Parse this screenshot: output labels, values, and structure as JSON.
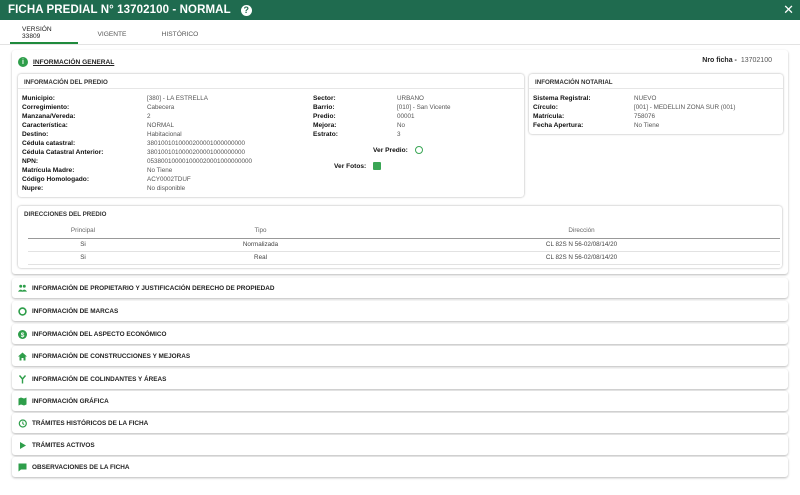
{
  "window": {
    "title": "FICHA PREDIAL N° 13702100 - NORMAL",
    "help_glyph": "?",
    "close_glyph": "✕"
  },
  "tabs": [
    {
      "label": "VERSIÓN 33809"
    },
    {
      "label": "VIGENTE"
    },
    {
      "label": "HISTÓRICO"
    }
  ],
  "general": {
    "label": "INFORMACIÓN GENERAL",
    "nro_ficha_label": "Nro ficha -",
    "nro_ficha_value": "13702100"
  },
  "predio": {
    "title": "INFORMACIÓN DEL PREDIO",
    "left": [
      {
        "k": "Municipio:",
        "v": "[380] - LA ESTRELLA"
      },
      {
        "k": "Corregimiento:",
        "v": "Cabecera"
      },
      {
        "k": "Manzana/Vereda:",
        "v": "2"
      },
      {
        "k": "Característica:",
        "v": "NORMAL"
      },
      {
        "k": "Destino:",
        "v": "Habitacional"
      },
      {
        "k": "Cédula catastral:",
        "v": "3801001010000200001000000000"
      },
      {
        "k": "Cédula Catastral Anterior:",
        "v": "3801001010000200001000000000"
      },
      {
        "k": "NPN:",
        "v": "053800100001000020001000000000"
      },
      {
        "k": "Matrícula Madre:",
        "v": "No Tiene"
      },
      {
        "k": "Código Homologado:",
        "v": "ACY0002TDUF"
      },
      {
        "k": "Nupre:",
        "v": "No disponible"
      }
    ],
    "right": [
      {
        "k": "Sector:",
        "v": "URBANO"
      },
      {
        "k": "Barrio:",
        "v": "[010] - San Vicente"
      },
      {
        "k": "Predio:",
        "v": "00001"
      },
      {
        "k": "Mejora:",
        "v": "No"
      },
      {
        "k": "Estrato:",
        "v": "3"
      }
    ],
    "ver_predio": "Ver Predio:",
    "ver_fotos": "Ver Fotos:"
  },
  "notarial": {
    "title": "INFORMACIÓN NOTARIAL",
    "rows": [
      {
        "k": "Sistema Registral:",
        "v": "NUEVO"
      },
      {
        "k": "Círculo:",
        "v": "[001] - MEDELLIN ZONA SUR (001)"
      },
      {
        "k": "Matrícula:",
        "v": "758076"
      },
      {
        "k": "Fecha Apertura:",
        "v": "No Tiene"
      }
    ]
  },
  "direcciones": {
    "title": "DIRECCIONES DEL PREDIO",
    "headers": [
      "Principal",
      "Tipo",
      "Dirección"
    ],
    "rows": [
      [
        "Si",
        "Normalizada",
        "CL 82S N 56-02/08/14/20"
      ],
      [
        "Si",
        "Real",
        "CL 82S N 56-02/08/14/20"
      ]
    ]
  },
  "sections": [
    {
      "label": "INFORMACIÓN DE PROPIETARIO Y JUSTIFICACIÓN DERECHO DE PROPIEDAD",
      "icon": "people-icon"
    },
    {
      "label": "INFORMACIÓN DE MARCAS",
      "icon": "ring-icon"
    },
    {
      "label": "INFORMACIÓN DEL ASPECTO ECONÓMICO",
      "icon": "dollar-icon"
    },
    {
      "label": "INFORMACIÓN DE CONSTRUCCIONES Y MEJORAS",
      "icon": "home-icon"
    },
    {
      "label": "INFORMACIÓN DE COLINDANTES Y ÁREAS",
      "icon": "merge-icon"
    },
    {
      "label": "INFORMACIÓN GRÁFICA",
      "icon": "map-icon"
    },
    {
      "label": "TRÁMITES HISTÓRICOS DE LA FICHA",
      "icon": "history-icon"
    },
    {
      "label": "TRÁMITES ACTIVOS",
      "icon": "play-icon"
    },
    {
      "label": "OBSERVACIONES DE LA FICHA",
      "icon": "comment-icon"
    }
  ],
  "colors": {
    "header": "#1f6b4f",
    "accent": "#2e9e4a"
  }
}
